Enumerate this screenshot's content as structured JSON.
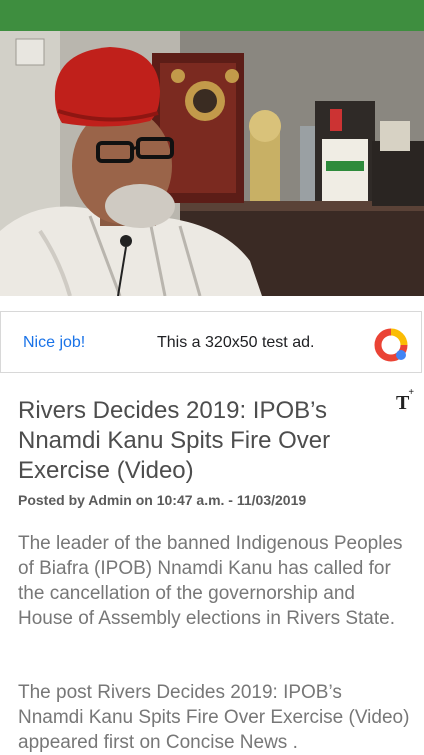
{
  "app_bar": {
    "color": "#3e8e3f"
  },
  "hero_image": {
    "icon": "photo-of-man-in-red-cap"
  },
  "ad": {
    "cta": "Nice job!",
    "text": "This a 320x50 test ad.",
    "logo_icon": "ads-logo-icon"
  },
  "controls": {
    "font_size_label": "T"
  },
  "article": {
    "title": "Rivers Decides 2019: IPOB’s Nnamdi Kanu Spits Fire Over Exercise (Video)",
    "meta": "Posted by Admin on 10:47 a.m. - 11/03/2019",
    "paragraphs": [
      "The leader of the banned Indigenous Peoples of Biafra (IPOB) Nnamdi Kanu has called for the cancellation of the governorship and House of Assembly elections in Rivers State.",
      "The post Rivers Decides 2019: IPOB’s Nnamdi Kanu Spits Fire Over Exercise (Video) appeared first on Concise News ."
    ]
  }
}
